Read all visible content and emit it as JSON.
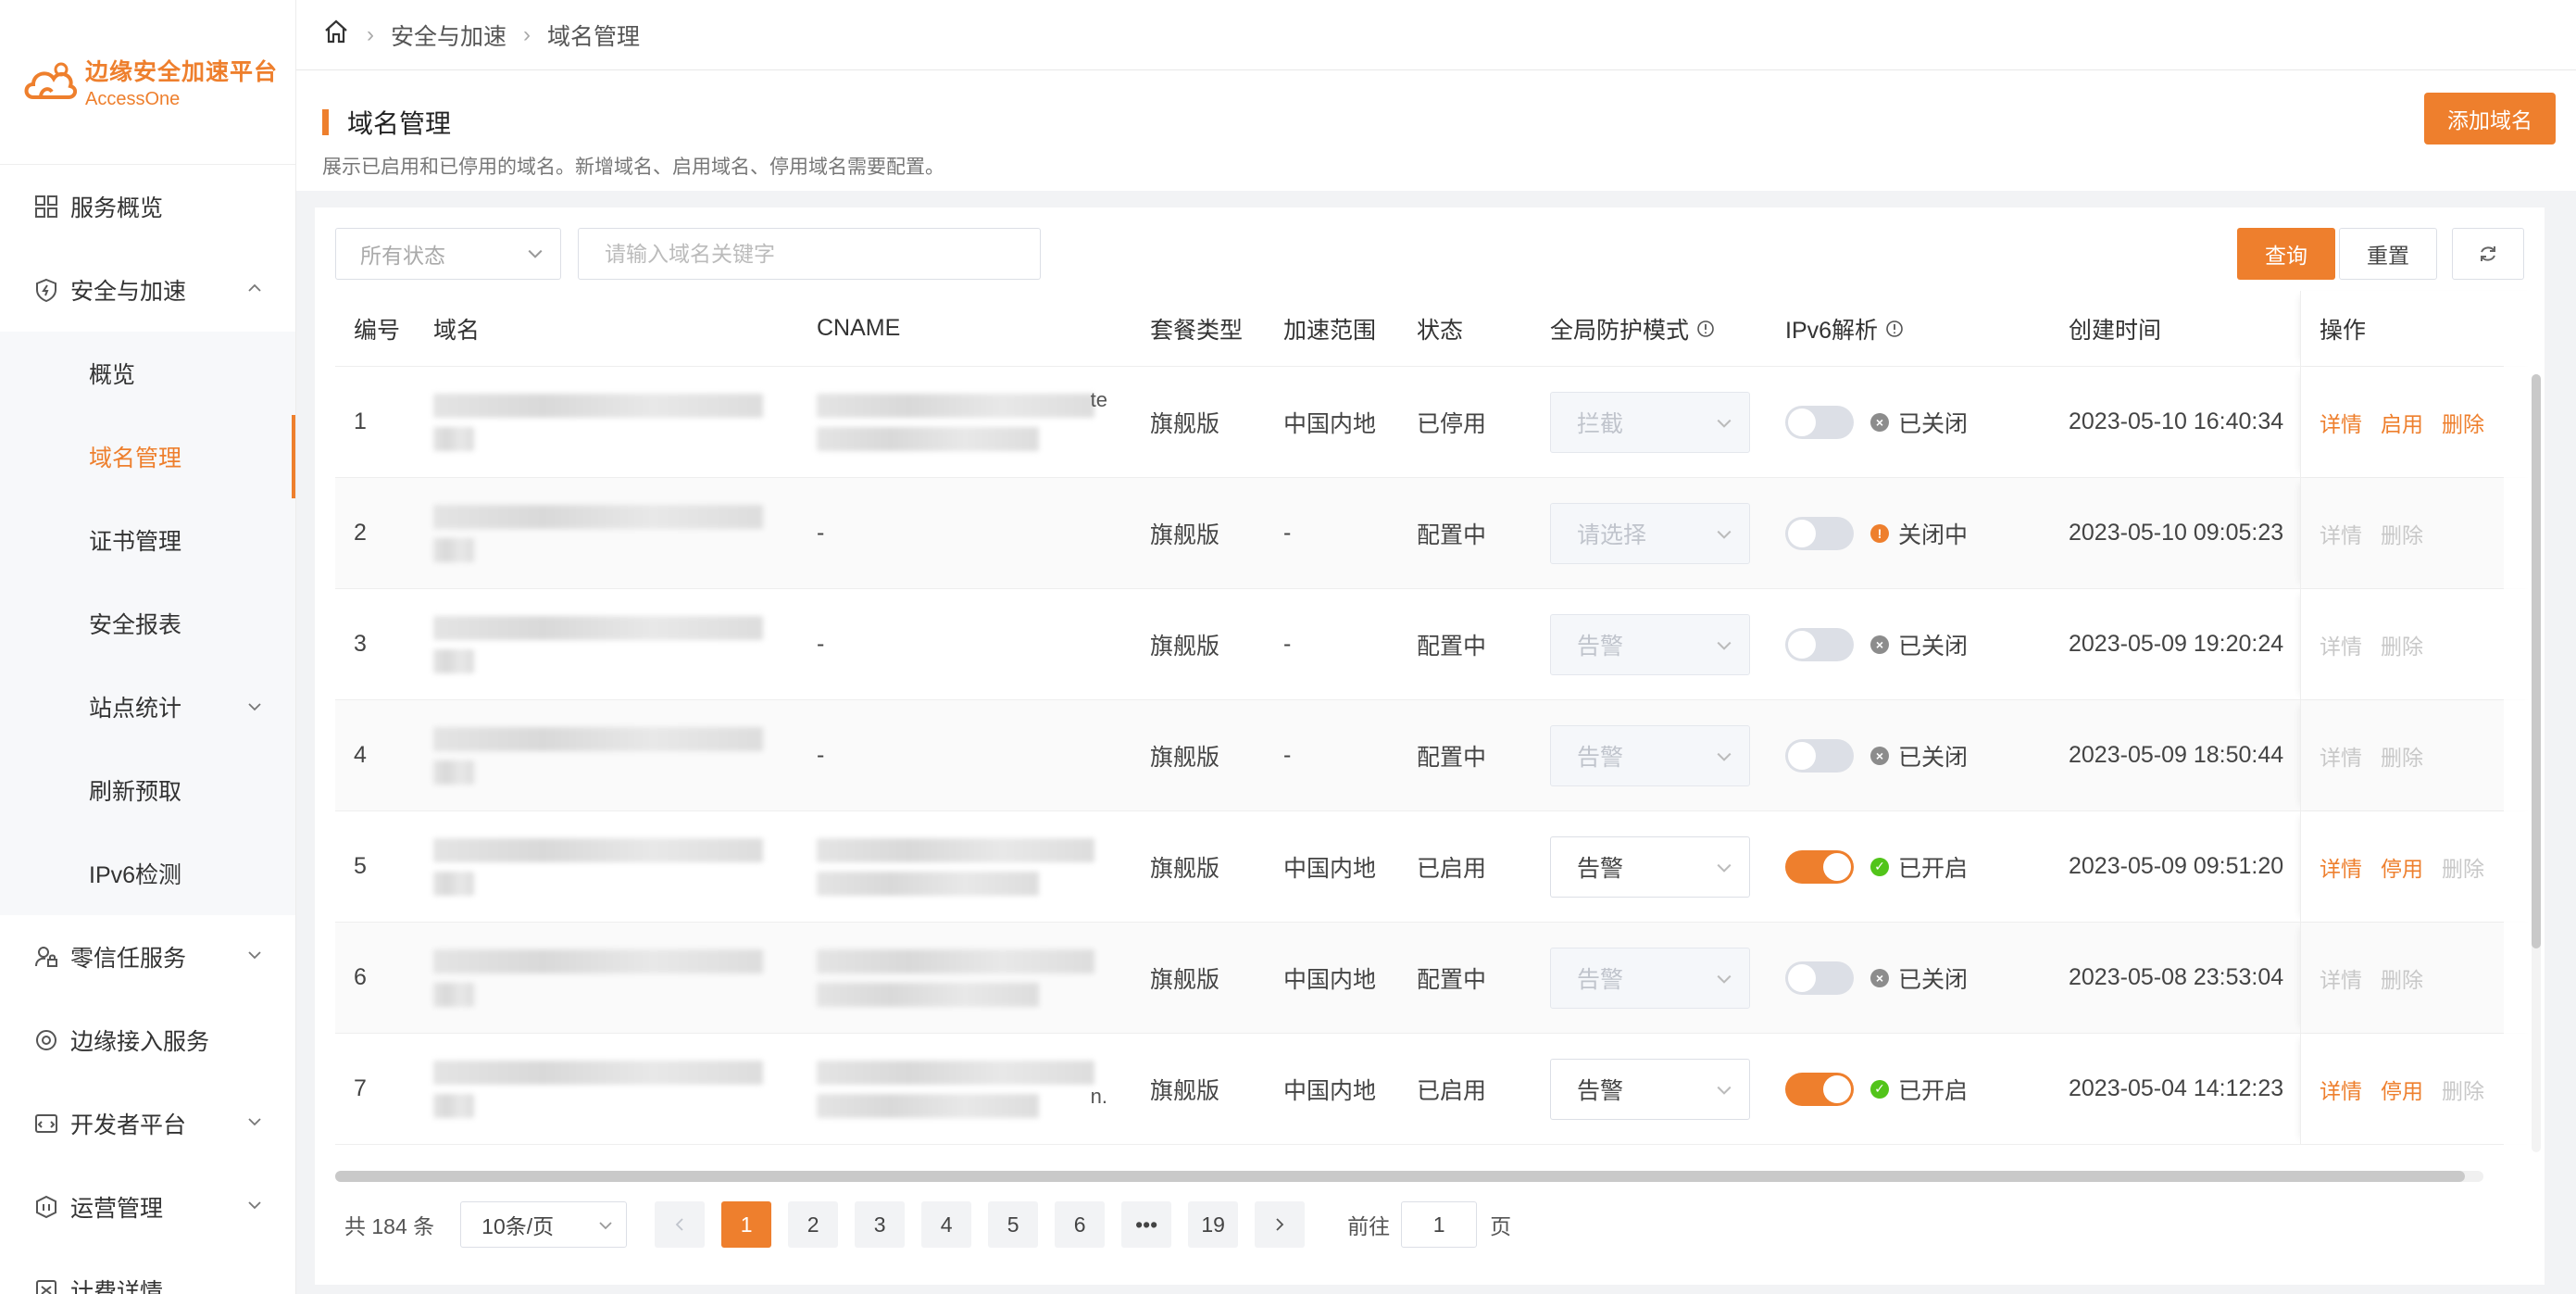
{
  "brand": {
    "title": "边缘安全加速平台",
    "subtitle": "AccessOne",
    "color": "#ee7f2d"
  },
  "sidebar": {
    "items": [
      {
        "label": "服务概览",
        "icon": "grid-icon"
      },
      {
        "label": "安全与加速",
        "icon": "shield-icon",
        "expanded": true,
        "children": [
          {
            "label": "概览"
          },
          {
            "label": "域名管理",
            "active": true
          },
          {
            "label": "证书管理"
          },
          {
            "label": "安全报表"
          },
          {
            "label": "站点统计",
            "has_children": true
          },
          {
            "label": "刷新预取"
          },
          {
            "label": "IPv6检测"
          }
        ]
      },
      {
        "label": "零信任服务",
        "icon": "person-lock-icon"
      },
      {
        "label": "边缘接入服务",
        "icon": "edge-access-icon"
      },
      {
        "label": "开发者平台",
        "icon": "developer-icon"
      },
      {
        "label": "运营管理",
        "icon": "operations-icon"
      },
      {
        "label": "计费详情",
        "icon": "billing-icon"
      }
    ]
  },
  "breadcrumb": [
    "安全与加速",
    "域名管理"
  ],
  "page": {
    "title": "域名管理",
    "description": "展示已启用和已停用的域名。新增域名、启用域名、停用域名需要配置。",
    "add_button": "添加域名"
  },
  "filters": {
    "status_placeholder": "所有状态",
    "search_placeholder": "请输入域名关键字",
    "query_button": "查询",
    "reset_button": "重置"
  },
  "table": {
    "columns": [
      "编号",
      "域名",
      "CNAME",
      "套餐类型",
      "加速范围",
      "状态",
      "全局防护模式",
      "IPv6解析",
      "创建时间",
      "操作"
    ],
    "rows": [
      {
        "no": "1",
        "cname_visible": "te",
        "plan": "旗舰版",
        "scope": "中国内地",
        "state": "已停用",
        "mode": "拦截",
        "mode_enabled": false,
        "ipv6_on": false,
        "ipv6_status": "已关闭",
        "ipv6_dot": "grey",
        "time": "2023-05-10 16:40:34",
        "ops": [
          {
            "label": "详情",
            "enabled": true
          },
          {
            "label": "启用",
            "enabled": true
          },
          {
            "label": "删除",
            "enabled": true
          }
        ],
        "cname_blurred": true
      },
      {
        "no": "2",
        "cname_text": "-",
        "plan": "旗舰版",
        "scope": "-",
        "state": "配置中",
        "mode": "请选择",
        "mode_enabled": false,
        "ipv6_on": false,
        "ipv6_status": "关闭中",
        "ipv6_dot": "orange",
        "time": "2023-05-10 09:05:23",
        "ops": [
          {
            "label": "详情",
            "enabled": false
          },
          {
            "label": "删除",
            "enabled": false
          }
        ],
        "cname_blurred": false
      },
      {
        "no": "3",
        "cname_text": "-",
        "plan": "旗舰版",
        "scope": "-",
        "state": "配置中",
        "mode": "告警",
        "mode_enabled": false,
        "ipv6_on": false,
        "ipv6_status": "已关闭",
        "ipv6_dot": "grey",
        "time": "2023-05-09 19:20:24",
        "ops": [
          {
            "label": "详情",
            "enabled": false
          },
          {
            "label": "删除",
            "enabled": false
          }
        ],
        "cname_blurred": false
      },
      {
        "no": "4",
        "cname_text": "-",
        "plan": "旗舰版",
        "scope": "-",
        "state": "配置中",
        "mode": "告警",
        "mode_enabled": false,
        "ipv6_on": false,
        "ipv6_status": "已关闭",
        "ipv6_dot": "grey",
        "time": "2023-05-09 18:50:44",
        "ops": [
          {
            "label": "详情",
            "enabled": false
          },
          {
            "label": "删除",
            "enabled": false
          }
        ],
        "cname_blurred": false
      },
      {
        "no": "5",
        "plan": "旗舰版",
        "scope": "中国内地",
        "state": "已启用",
        "mode": "告警",
        "mode_enabled": true,
        "ipv6_on": true,
        "ipv6_status": "已开启",
        "ipv6_dot": "green",
        "time": "2023-05-09 09:51:20",
        "ops": [
          {
            "label": "详情",
            "enabled": true
          },
          {
            "label": "停用",
            "enabled": true
          },
          {
            "label": "删除",
            "enabled": false
          }
        ],
        "cname_blurred": true
      },
      {
        "no": "6",
        "plan": "旗舰版",
        "scope": "中国内地",
        "state": "配置中",
        "mode": "告警",
        "mode_enabled": false,
        "ipv6_on": false,
        "ipv6_status": "已关闭",
        "ipv6_dot": "grey",
        "time": "2023-05-08 23:53:04",
        "ops": [
          {
            "label": "详情",
            "enabled": false
          },
          {
            "label": "删除",
            "enabled": false
          }
        ],
        "cname_blurred": true
      },
      {
        "no": "7",
        "cname_visible": "n.",
        "plan": "旗舰版",
        "scope": "中国内地",
        "state": "已启用",
        "mode": "告警",
        "mode_enabled": true,
        "ipv6_on": true,
        "ipv6_status": "已开启",
        "ipv6_dot": "green",
        "time": "2023-05-04 14:12:23",
        "ops": [
          {
            "label": "详情",
            "enabled": true
          },
          {
            "label": "停用",
            "enabled": true
          },
          {
            "label": "删除",
            "enabled": false
          }
        ],
        "cname_blurred": true
      }
    ]
  },
  "pagination": {
    "total": "共 184 条",
    "page_size": "10条/页",
    "pages": [
      "1",
      "2",
      "3",
      "4",
      "5",
      "6",
      "•••",
      "19"
    ],
    "current": "1",
    "goto_prefix": "前往",
    "goto_value": "1",
    "goto_suffix": "页"
  }
}
